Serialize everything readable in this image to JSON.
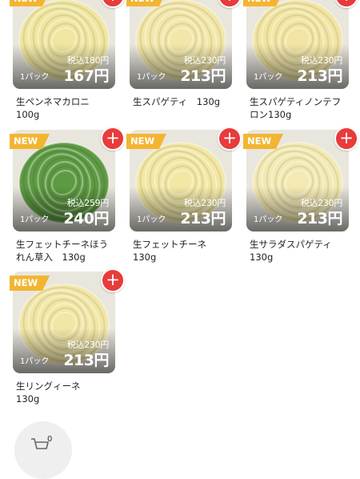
{
  "products": [
    {
      "name": "生ペンネマカロニ\n100g",
      "tax_price": "税込180円",
      "pack": "1パック",
      "price": "167円",
      "badge": "NEW",
      "pasta_color": "#f0e6a0"
    },
    {
      "name": "生スパゲティ　130g",
      "tax_price": "税込230円",
      "pack": "1パック",
      "price": "213円",
      "badge": "NEW",
      "pasta_color": "#f2e7a8"
    },
    {
      "name": "生スパゲティノンテフ\nロン130g",
      "tax_price": "税込230円",
      "pack": "1パック",
      "price": "213円",
      "badge": "NEW",
      "pasta_color": "#f2e5a3"
    },
    {
      "name": "生フェットチーネほう\nれん草入　130g",
      "tax_price": "税込259円",
      "pack": "1パック",
      "price": "240円",
      "badge": "NEW",
      "pasta_color": "#5e9a43"
    },
    {
      "name": "生フェットチーネ\n130g",
      "tax_price": "税込230円",
      "pack": "1パック",
      "price": "213円",
      "badge": "NEW",
      "pasta_color": "#f2e7a4"
    },
    {
      "name": "生サラダスパゲティ\n130g",
      "tax_price": "税込230円",
      "pack": "1パック",
      "price": "213円",
      "badge": "NEW",
      "pasta_color": "#f3e9b2"
    },
    {
      "name": "生リングィーネ\n130g",
      "tax_price": "税込230円",
      "pack": "1パック",
      "price": "213円",
      "badge": "NEW",
      "pasta_color": "#f2e6a6"
    }
  ],
  "add_symbol": "+",
  "cart": {
    "count": "0"
  },
  "colors": {
    "new_badge": "#f3b531",
    "add_button": "#e83b3b",
    "cart_bg": "#efefef"
  }
}
